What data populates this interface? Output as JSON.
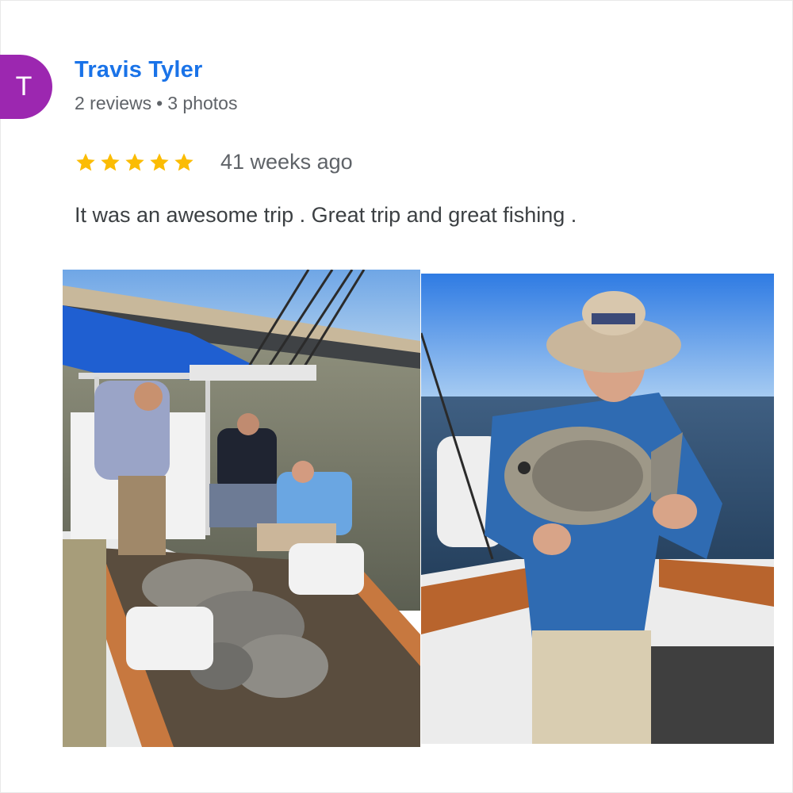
{
  "review": {
    "avatar_letter": "T",
    "avatar_color": "#9c27b0",
    "author": "Travis Tyler",
    "reviews_count": "2 reviews",
    "separator": "•",
    "photos_count": "3 photos",
    "rating": 5,
    "rating_max": 5,
    "star_color": "#fbbc04",
    "date": "41 weeks ago",
    "text": "It was an awesome trip . Great trip and great fishing ."
  },
  "photos": {
    "photo1_icon": "boat-fishing-photo",
    "photo2_icon": "angler-holding-fish-photo"
  },
  "colors": {
    "name_link": "#1a73e8",
    "secondary_text": "#5f6368",
    "body_text": "#3c4043"
  }
}
